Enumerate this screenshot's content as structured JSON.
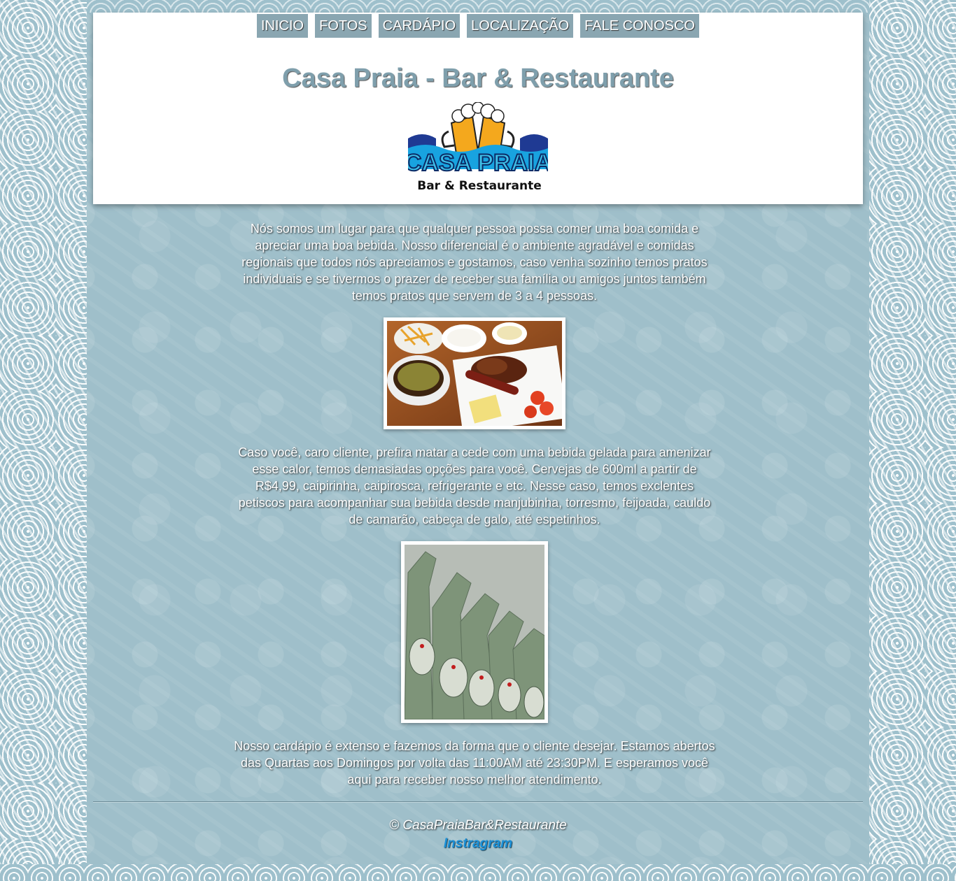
{
  "nav": {
    "items": [
      {
        "label": "INICIO"
      },
      {
        "label": "FOTOS"
      },
      {
        "label": "CARDÁPIO"
      },
      {
        "label": "LOCALIZAÇÃO"
      },
      {
        "label": "FALE CONOSCO"
      }
    ]
  },
  "header": {
    "title": "Casa Praia - Bar & Restaurante",
    "logo_text_main": "CASA PRAIA",
    "logo_text_sub": "Bar & Restaurante"
  },
  "content": {
    "paragraph_1": "Nós somos um lugar para que qualquer pessoa possa comer uma boa comida e apreciar uma boa bebida. Nosso diferencial é o ambiente agradável e comidas regionais que todos nós apreciamos e gostamos, caso venha sozinho temos pratos individuais e se tivermos o prazer de receber sua família ou amigos juntos também temos pratos que servem de 3 a 4 pessoas.",
    "paragraph_2": "Caso você, caro cliente, prefira matar a cede com uma bebida gelada para amenizar esse calor, temos demasiadas opções para você. Cervejas de 600ml a partir de R$4,99, caipirinha, caipirosca, refrigerante e etc. Nesse caso, temos exclentes petiscos para acompanhar sua bebida desde manjubinha, torresmo, feijoada, cauldo de camarão, cabeça de galo, até espetinhos.",
    "paragraph_3": "Nosso cardápio é extenso e fazemos da forma que o cliente desejar. Estamos abertos das Quartas aos Domingos por volta das 11:00AM até 23:30PM. E esperamos você aqui para receber nosso melhor atendimento."
  },
  "footer": {
    "copyright": "© CasaPraiaBar&Restaurante",
    "instagram_label": "Instragram"
  },
  "colors": {
    "background": "#9fbfca",
    "nav_button": "#8aa6b1",
    "title": "#7f9fac",
    "link": "#1a8fd6"
  }
}
